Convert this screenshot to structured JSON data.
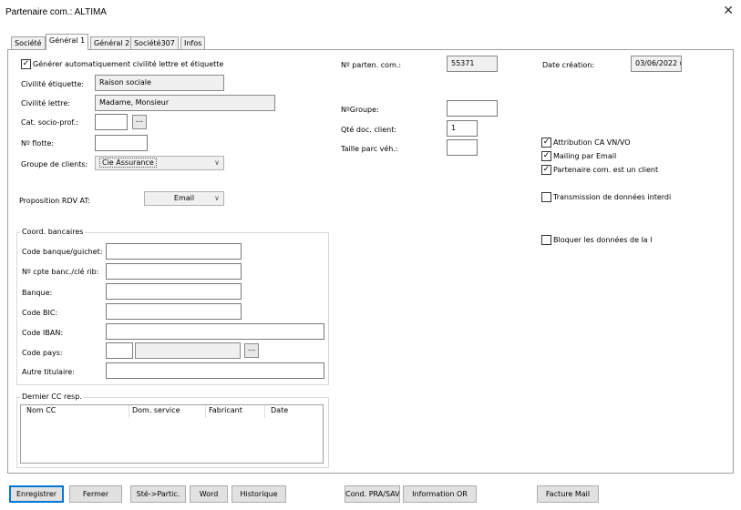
{
  "window": {
    "title": "Partenaire com.: ALTIMA",
    "close_glyph": "✕"
  },
  "tabs": [
    {
      "label": "Société"
    },
    {
      "label": "Général 1"
    },
    {
      "label": "Général 2"
    },
    {
      "label": "Société307"
    },
    {
      "label": "Infos"
    }
  ],
  "left": {
    "auto_civility_label": "Générer automatiquement civilité lettre et étiquette",
    "civ_etiquette_label": "Civilité étiquette:",
    "civ_etiquette_value": "Raison sociale",
    "civ_lettre_label": "Civilité lettre:",
    "civ_lettre_value": "Madame, Monsieur",
    "cat_socio_label": "Cat. socio-prof.:",
    "cat_socio_value": "",
    "ellipsis": "...",
    "flotte_label": "Nº flotte:",
    "flotte_value": "",
    "groupe_clients_label": "Groupe de clients:",
    "groupe_clients_value": "Cie Assurance",
    "rdv_label": "Proposition RDV AT:",
    "rdv_value": "Email"
  },
  "bank": {
    "title": "Coord. bancaires",
    "code_banque_label": "Code banque/guichet:",
    "cpte_label": "Nº cpte banc./clé rib:",
    "banque_label": "Banque:",
    "bic_label": "Code BIC:",
    "iban_label": "Code IBAN:",
    "pays_label": "Code pays:",
    "titulaire_label": "Autre titulaire:",
    "ellipsis": "..."
  },
  "cc": {
    "title": "Dernier CC resp.",
    "columns": [
      "Nom CC",
      "Dom. service",
      "Fabricant",
      "Date"
    ]
  },
  "middle": {
    "num_parten_label": "Nº parten. com.:",
    "num_parten_value": "55371",
    "groupe_label": "NºGroupe:",
    "groupe_value": "",
    "qte_label": "Qté doc. client:",
    "qte_value": "1",
    "taille_label": "Taille parc véh.:",
    "taille_value": ""
  },
  "right": {
    "date_creation_label": "Date création:",
    "date_creation_value": "03/06/2022 (",
    "checkboxes": [
      {
        "label": "Attribution CA VN/VO",
        "checked": true
      },
      {
        "label": "Mailing par Email",
        "checked": true
      },
      {
        "label": "Partenaire com. est un client",
        "checked": true
      },
      {
        "label": "Transmission de données interdi",
        "checked": false
      },
      {
        "label": "Bloquer les données de la l",
        "checked": false
      }
    ]
  },
  "buttons": {
    "save": "Enregistrer",
    "close": "Fermer",
    "ste_partic": "Sté->Partic.",
    "word": "Word",
    "historique": "Historique",
    "cond": "Cond. PRA/SAV",
    "info_or": "Information OR",
    "facture_mail": "Facture Mail"
  }
}
